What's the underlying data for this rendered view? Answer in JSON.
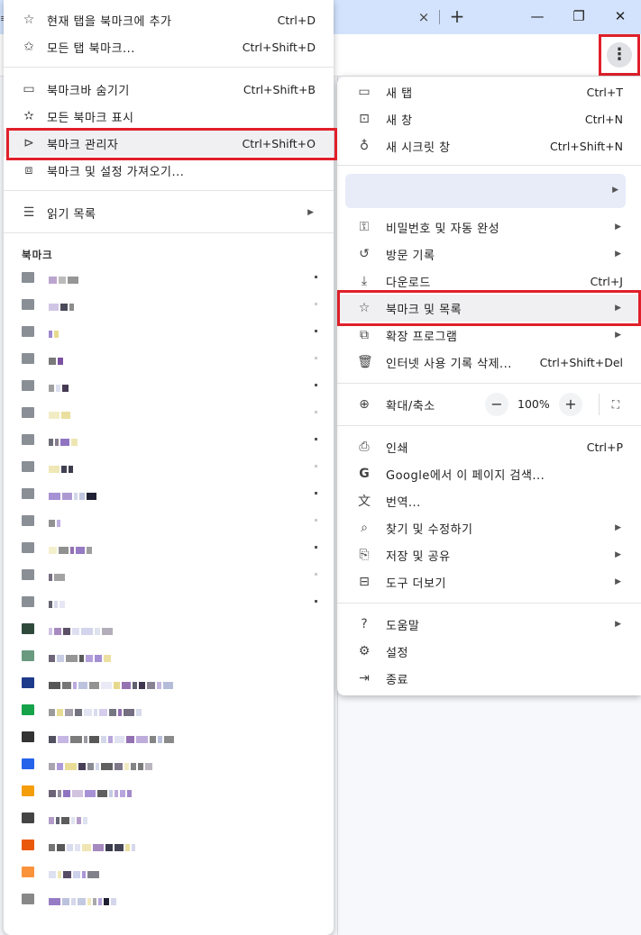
{
  "window": {
    "close_tab_glyph": "×",
    "new_tab_glyph": "+",
    "minimize_glyph": "—",
    "maximize_glyph": "❐",
    "close_glyph": "✕",
    "kebab_glyph": "⋮"
  },
  "main_menu": {
    "new_tab": {
      "label": "새 탭",
      "shortcut": "Ctrl+T"
    },
    "new_window": {
      "label": "새 창",
      "shortcut": "Ctrl+N"
    },
    "incognito": {
      "label": "새 시크릿 창",
      "shortcut": "Ctrl+Shift+N"
    },
    "passwords": {
      "label": "비밀번호 및 자동 완성"
    },
    "history": {
      "label": "방문 기록"
    },
    "downloads": {
      "label": "다운로드",
      "shortcut": "Ctrl+J"
    },
    "bookmarks": {
      "label": "북마크 및 목록"
    },
    "extensions": {
      "label": "확장 프로그램"
    },
    "clear_data": {
      "label": "인터넷 사용 기록 삭제...",
      "shortcut": "Ctrl+Shift+Del"
    },
    "zoom": {
      "label": "확대/축소",
      "minus": "−",
      "value": "100%",
      "plus": "+"
    },
    "print": {
      "label": "인쇄",
      "shortcut": "Ctrl+P"
    },
    "google_search": {
      "label": "Google에서 이 페이지 검색..."
    },
    "translate": {
      "label": "번역..."
    },
    "find_edit": {
      "label": "찾기 및 수정하기"
    },
    "save_share": {
      "label": "저장 및 공유"
    },
    "more_tools": {
      "label": "도구 더보기"
    },
    "help": {
      "label": "도움말"
    },
    "settings": {
      "label": "설정"
    },
    "exit": {
      "label": "종료"
    }
  },
  "bookmark_menu": {
    "add_bookmark": {
      "label": "현재 탭을 북마크에 추가",
      "shortcut": "Ctrl+D"
    },
    "bookmark_all": {
      "label": "모든 탭 북마크...",
      "shortcut": "Ctrl+Shift+D"
    },
    "hide_bar": {
      "label": "북마크바 숨기기",
      "shortcut": "Ctrl+Shift+B"
    },
    "show_all": {
      "label": "모든 북마크 표시"
    },
    "manager": {
      "label": "북마크 관리자",
      "shortcut": "Ctrl+Shift+O"
    },
    "import": {
      "label": "북마크 및 설정 가져오기..."
    },
    "reading_list": {
      "label": "읽기 목록"
    },
    "section_title": "북마크"
  },
  "icons": {
    "arrow": "▶"
  },
  "accent": {
    "highlight_red": "#e0202a",
    "tab_strip": "#d3e3fd"
  }
}
